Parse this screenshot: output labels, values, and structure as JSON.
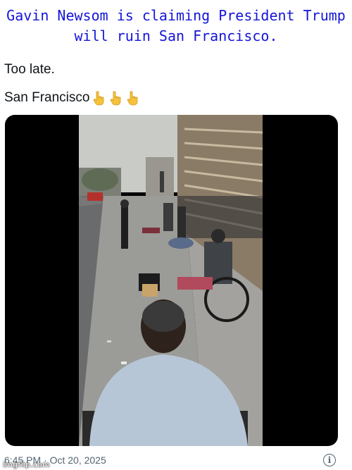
{
  "meme": {
    "caption": "Gavin Newsom is claiming President Trump will ruin San Francisco.",
    "watermark": "imgflip.com"
  },
  "post": {
    "line1": "Too late.",
    "line2": "San Francisco",
    "emojis": [
      "pointing-down-icon",
      "pointing-down-icon",
      "pointing-down-icon"
    ],
    "timestamp": "6:45 PM · Oct 20, 2025",
    "info_icon_glyph": "i"
  },
  "colors": {
    "caption": "#1515d8",
    "text": "#0f1419",
    "muted": "#536471",
    "emoji": "#f7c23b"
  }
}
